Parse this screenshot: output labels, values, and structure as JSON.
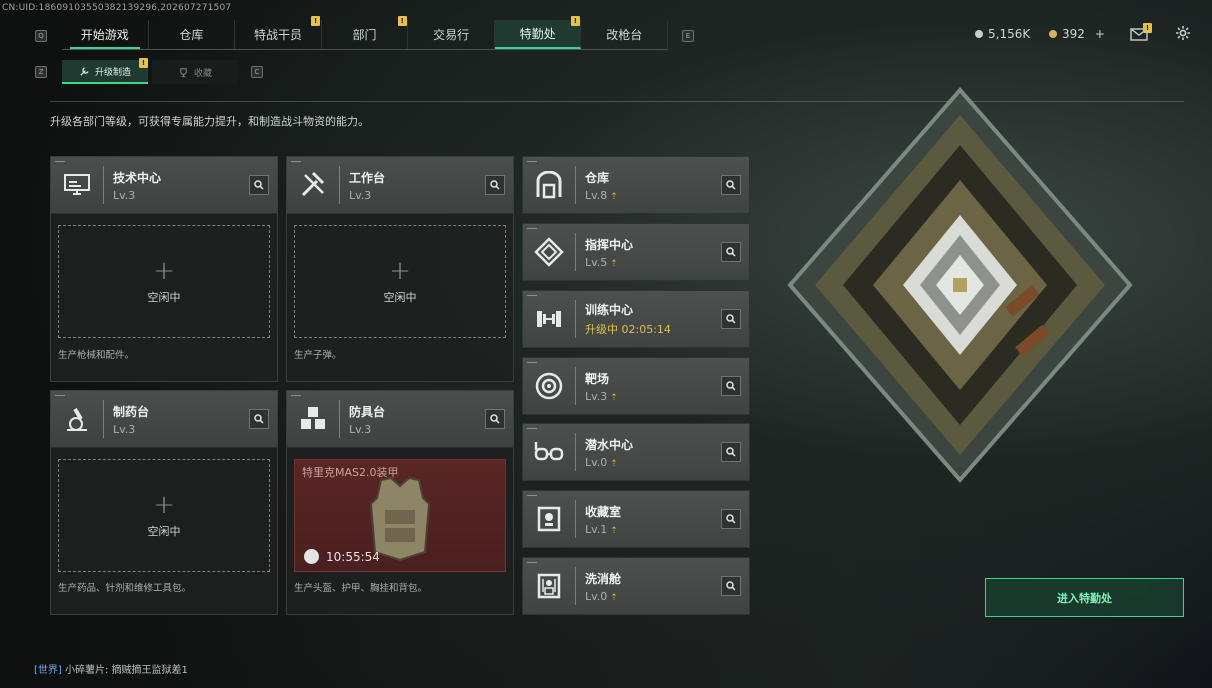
{
  "uid": "CN:UID:18609103550382139296,202607271507",
  "nav": {
    "tabs": [
      {
        "label": "开始游戏",
        "badge": ""
      },
      {
        "label": "仓库",
        "badge": ""
      },
      {
        "label": "特战干员",
        "badge": "!"
      },
      {
        "label": "部门",
        "badge": "!"
      },
      {
        "label": "交易行",
        "badge": ""
      },
      {
        "label": "特勤处",
        "badge": "!"
      },
      {
        "label": "改枪台",
        "badge": ""
      }
    ],
    "active": "特勤处",
    "key_left": "Q",
    "key_right": "E"
  },
  "subnav": {
    "tabs": [
      {
        "label": "升级制造",
        "badge": "!"
      },
      {
        "label": "收藏",
        "badge": ""
      }
    ],
    "key_left": "Z",
    "key_right": "C"
  },
  "currency": {
    "silver": "5,156K",
    "gold": "392",
    "add": "+"
  },
  "description": "升级各部门等级，可获得专属能力提升，和制造战斗物资的能力。",
  "craft_cards": [
    {
      "name": "技术中心",
      "level": "Lv.3",
      "idle": "空闲中",
      "plus": "+",
      "desc": "生产枪械和配件。"
    },
    {
      "name": "工作台",
      "level": "Lv.3",
      "idle": "空闲中",
      "plus": "+",
      "desc": "生产子弹。"
    },
    {
      "name": "制药台",
      "level": "Lv.3",
      "idle": "空闲中",
      "plus": "+",
      "desc": "生产药品、针剂和维修工具包。"
    },
    {
      "name": "防具台",
      "level": "Lv.3",
      "crafting_item": "特里克MAS2.0装甲",
      "timer": "10:55:54",
      "desc": "生产头盔、护甲、胸挂和背包。"
    }
  ],
  "facilities": [
    {
      "name": "仓库",
      "level": "Lv.8",
      "upgradable": true
    },
    {
      "name": "指挥中心",
      "level": "Lv.5",
      "upgradable": true
    },
    {
      "name": "训练中心",
      "level": "升级中 02:05:14",
      "upgradable": false
    },
    {
      "name": "靶场",
      "level": "Lv.3",
      "upgradable": true
    },
    {
      "name": "潜水中心",
      "level": "Lv.0",
      "upgradable": true
    },
    {
      "name": "收藏室",
      "level": "Lv.1",
      "upgradable": true
    },
    {
      "name": "洗消舱",
      "level": "Lv.0",
      "upgradable": true
    }
  ],
  "enter_button": "进入特勤处",
  "chat": {
    "channel": "[世界]",
    "user": "小碎薯片:",
    "message": "摘贼摘王监狱差1"
  },
  "colors": {
    "accent": "#3fd38c",
    "badge": "#e7c24a",
    "upgrade_arrow": "#e2b23d"
  }
}
